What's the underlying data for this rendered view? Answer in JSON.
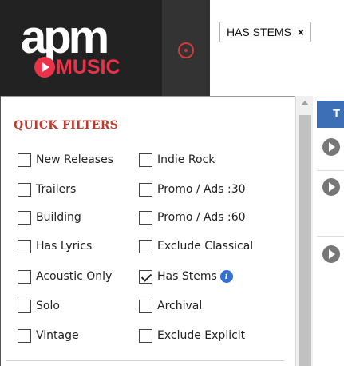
{
  "brand": {
    "logo_text": "apm",
    "logo_sub": "MUSIC"
  },
  "search": {
    "chip_label": "HAS STEMS",
    "chip_remove": "×"
  },
  "quick_filters": {
    "title": "QUICK FILTERS",
    "left": [
      {
        "label": "New Releases",
        "checked": false
      },
      {
        "label": "Trailers",
        "checked": false
      },
      {
        "label": "Building",
        "checked": false
      },
      {
        "label": "Has Lyrics",
        "checked": false
      },
      {
        "label": "Acoustic Only",
        "checked": false
      },
      {
        "label": "Solo",
        "checked": false
      },
      {
        "label": "Vintage",
        "checked": false
      }
    ],
    "right": [
      {
        "label": "Indie Rock",
        "checked": false
      },
      {
        "label": "Promo / Ads :30",
        "checked": false
      },
      {
        "label": "Promo / Ads :60",
        "checked": false
      },
      {
        "label": "Exclude Classical",
        "checked": false
      },
      {
        "label": "Has Stems",
        "checked": true
      },
      {
        "label": "Archival",
        "checked": false
      },
      {
        "label": "Exclude Explicit",
        "checked": false
      }
    ]
  },
  "results": {
    "header_initial": "T"
  },
  "colors": {
    "accent": "#c0392b",
    "brand_red": "#e8334a",
    "results_header": "#3d6fb6",
    "info": "#2f6fd6"
  }
}
